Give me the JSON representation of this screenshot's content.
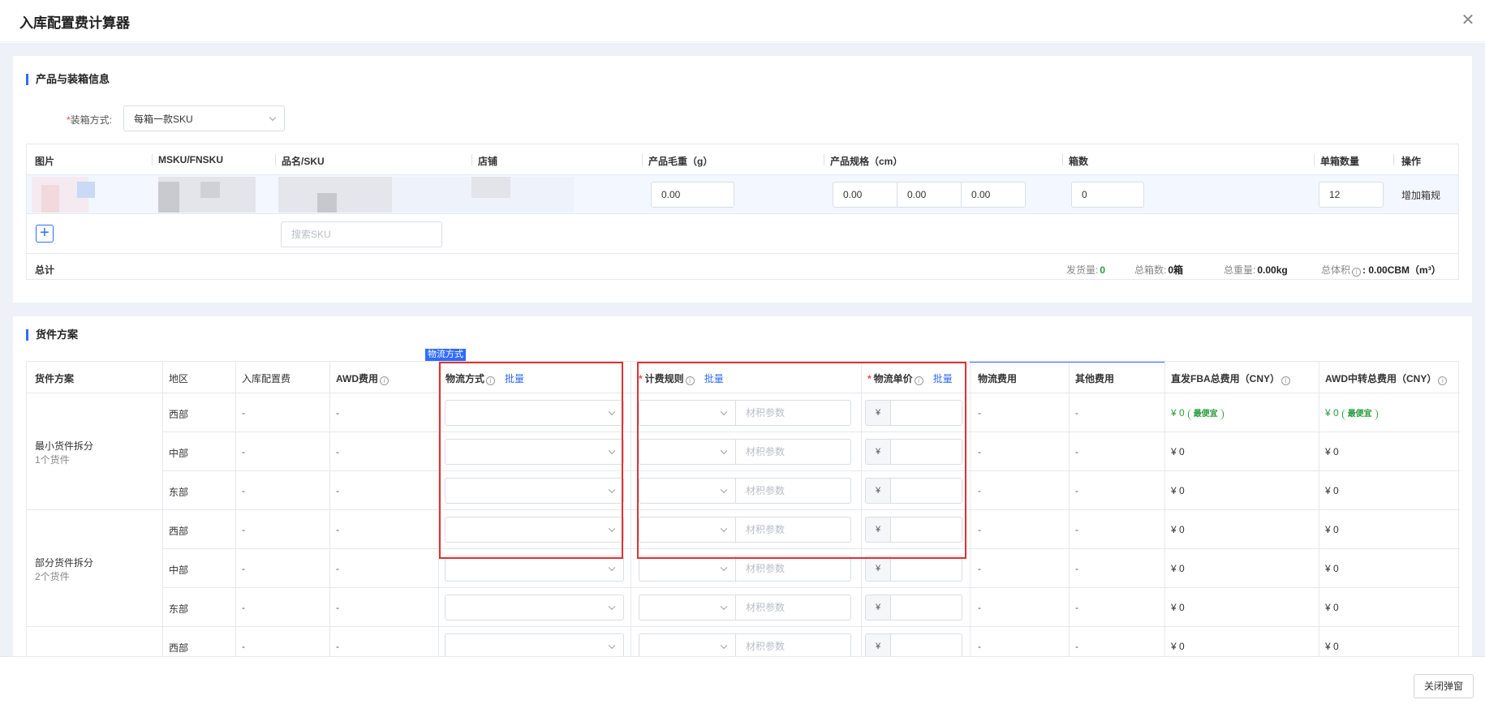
{
  "modal": {
    "title": "入库配置费计算器",
    "close_button": "关闭弹窗"
  },
  "product_section": {
    "title": "产品与装箱信息",
    "packing_label": "装箱方式:",
    "packing_value": "每箱一款SKU",
    "headers": [
      "图片",
      "MSKU/FNSKU",
      "品名/SKU",
      "店铺",
      "产品毛重（g）",
      "产品规格（cm）",
      "箱数",
      "单箱数量",
      "操作"
    ],
    "row": {
      "weight": "0.00",
      "length": "0.00",
      "width": "0.00",
      "height": "0.00",
      "boxes": "0",
      "per_box": "12",
      "action": "增加箱规"
    },
    "search_placeholder": "搜索SKU",
    "total_label": "总计",
    "stats": {
      "shipped_label": "发货量:",
      "shipped_value": "0",
      "boxes_label": "总箱数:",
      "boxes_value": "0箱",
      "weight_label": "总重量:",
      "weight_value": "0.00kg",
      "volume_label": "总体积",
      "volume_value": ": 0.00CBM（m³）"
    }
  },
  "plan_section": {
    "title": "货件方案",
    "tag": "物流方式",
    "headers": {
      "plan": "货件方案",
      "region": "地区",
      "inbound_fee": "入库配置费",
      "awd_fee": "AWD费用",
      "logistics": "物流方式",
      "batch": "批量",
      "rule": "计费规则",
      "unit_price": "物流单价",
      "logistics_cost": "物流费用",
      "other_cost": "其他费用",
      "fba_total": "直发FBA总费用（CNY）",
      "awd_total": "AWD中转总费用（CNY）"
    },
    "dash": "-",
    "param_placeholder": "材积参数",
    "yen": "¥",
    "cheapest": "最便宜",
    "groups": [
      {
        "name": "最小货件拆分",
        "sub": "1个货件"
      },
      {
        "name": "部分货件拆分",
        "sub": "2个货件"
      }
    ],
    "rows": [
      {
        "region": "西部",
        "fba": "¥ 0",
        "awd": "¥ 0",
        "cheapest": true
      },
      {
        "region": "中部",
        "fba": "¥ 0",
        "awd": "¥ 0",
        "cheapest": false
      },
      {
        "region": "东部",
        "fba": "¥ 0",
        "awd": "¥ 0",
        "cheapest": false
      },
      {
        "region": "西部",
        "fba": "¥ 0",
        "awd": "¥ 0",
        "cheapest": false
      },
      {
        "region": "中部",
        "fba": "¥ 0",
        "awd": "¥ 0",
        "cheapest": false
      },
      {
        "region": "东部",
        "fba": "¥ 0",
        "awd": "¥ 0",
        "cheapest": false
      },
      {
        "region": "西部",
        "fba": "¥ 0",
        "awd": "¥ 0",
        "cheapest": false
      }
    ]
  },
  "colors": {
    "accent": "#2f6bff",
    "highlight": "#e03131",
    "success": "#2a9d3c"
  }
}
